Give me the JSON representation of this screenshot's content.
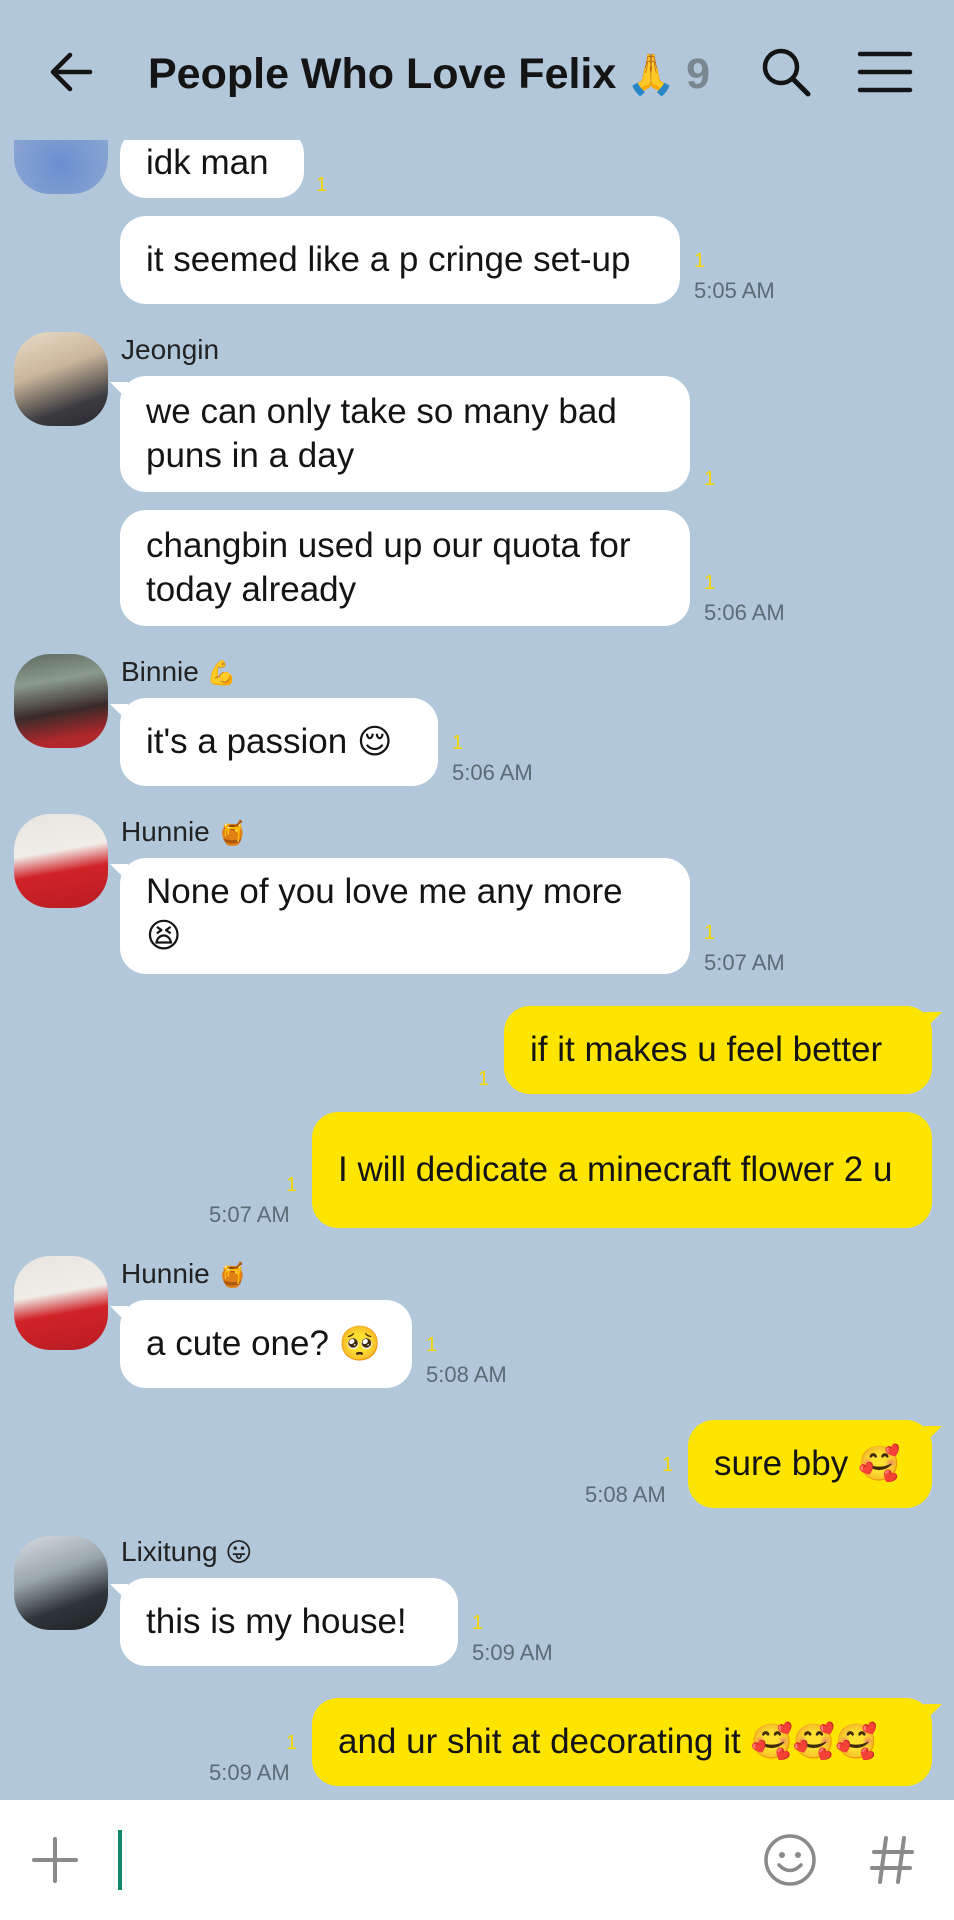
{
  "header": {
    "title": "People Who Love Felix",
    "title_emoji": "🙏",
    "member_count": "9"
  },
  "messages": [
    {
      "text": "idk man",
      "unread": "1",
      "time": ""
    },
    {
      "text": "it seemed like a p cringe set-up",
      "unread": "1",
      "time": "5:05 AM"
    },
    {
      "sender": "Jeongin",
      "text": "we can only take so many bad puns in a day",
      "unread": "1",
      "time": ""
    },
    {
      "text": "changbin used up our quota for today already",
      "unread": "1",
      "time": "5:06 AM"
    },
    {
      "sender": "Binnie",
      "sender_emoji": "💪",
      "text": "it's a passion",
      "emoji": "😌",
      "unread": "1",
      "time": "5:06 AM"
    },
    {
      "sender": "Hunnie",
      "sender_emoji": "🍯",
      "text": "None of you love me any more",
      "emoji": "😫",
      "unread": "1",
      "time": "5:07 AM"
    },
    {
      "text": "if it makes u feel better",
      "unread": "1",
      "time": ""
    },
    {
      "text": "I will dedicate a minecraft flower 2 u",
      "unread": "1",
      "time": "5:07 AM"
    },
    {
      "sender": "Hunnie",
      "sender_emoji": "🍯",
      "text": "a cute one?",
      "emoji": "🥺",
      "unread": "1",
      "time": "5:08 AM"
    },
    {
      "text": "sure bby",
      "emoji": "🥰",
      "unread": "1",
      "time": "5:08 AM"
    },
    {
      "sender": "Lixitung",
      "sender_emoji": "😛",
      "text": "this is my house!",
      "unread": "1",
      "time": "5:09 AM"
    },
    {
      "text": "and ur shit at decorating it",
      "emoji": "🥰🥰🥰",
      "unread": "1",
      "time": "5:09 AM"
    }
  ],
  "colors": {
    "background": "#b2c7d9",
    "incoming_bubble": "#ffffff",
    "outgoing_bubble": "#fee500",
    "unread": "#f7d800",
    "caret": "#0f8a6e"
  },
  "icons": {
    "back": "arrow-left-icon",
    "search": "search-icon",
    "menu": "hamburger-menu-icon",
    "add": "plus-icon",
    "emoji": "smiley-icon",
    "hashtag": "hash-icon"
  },
  "input": {
    "placeholder": ""
  }
}
